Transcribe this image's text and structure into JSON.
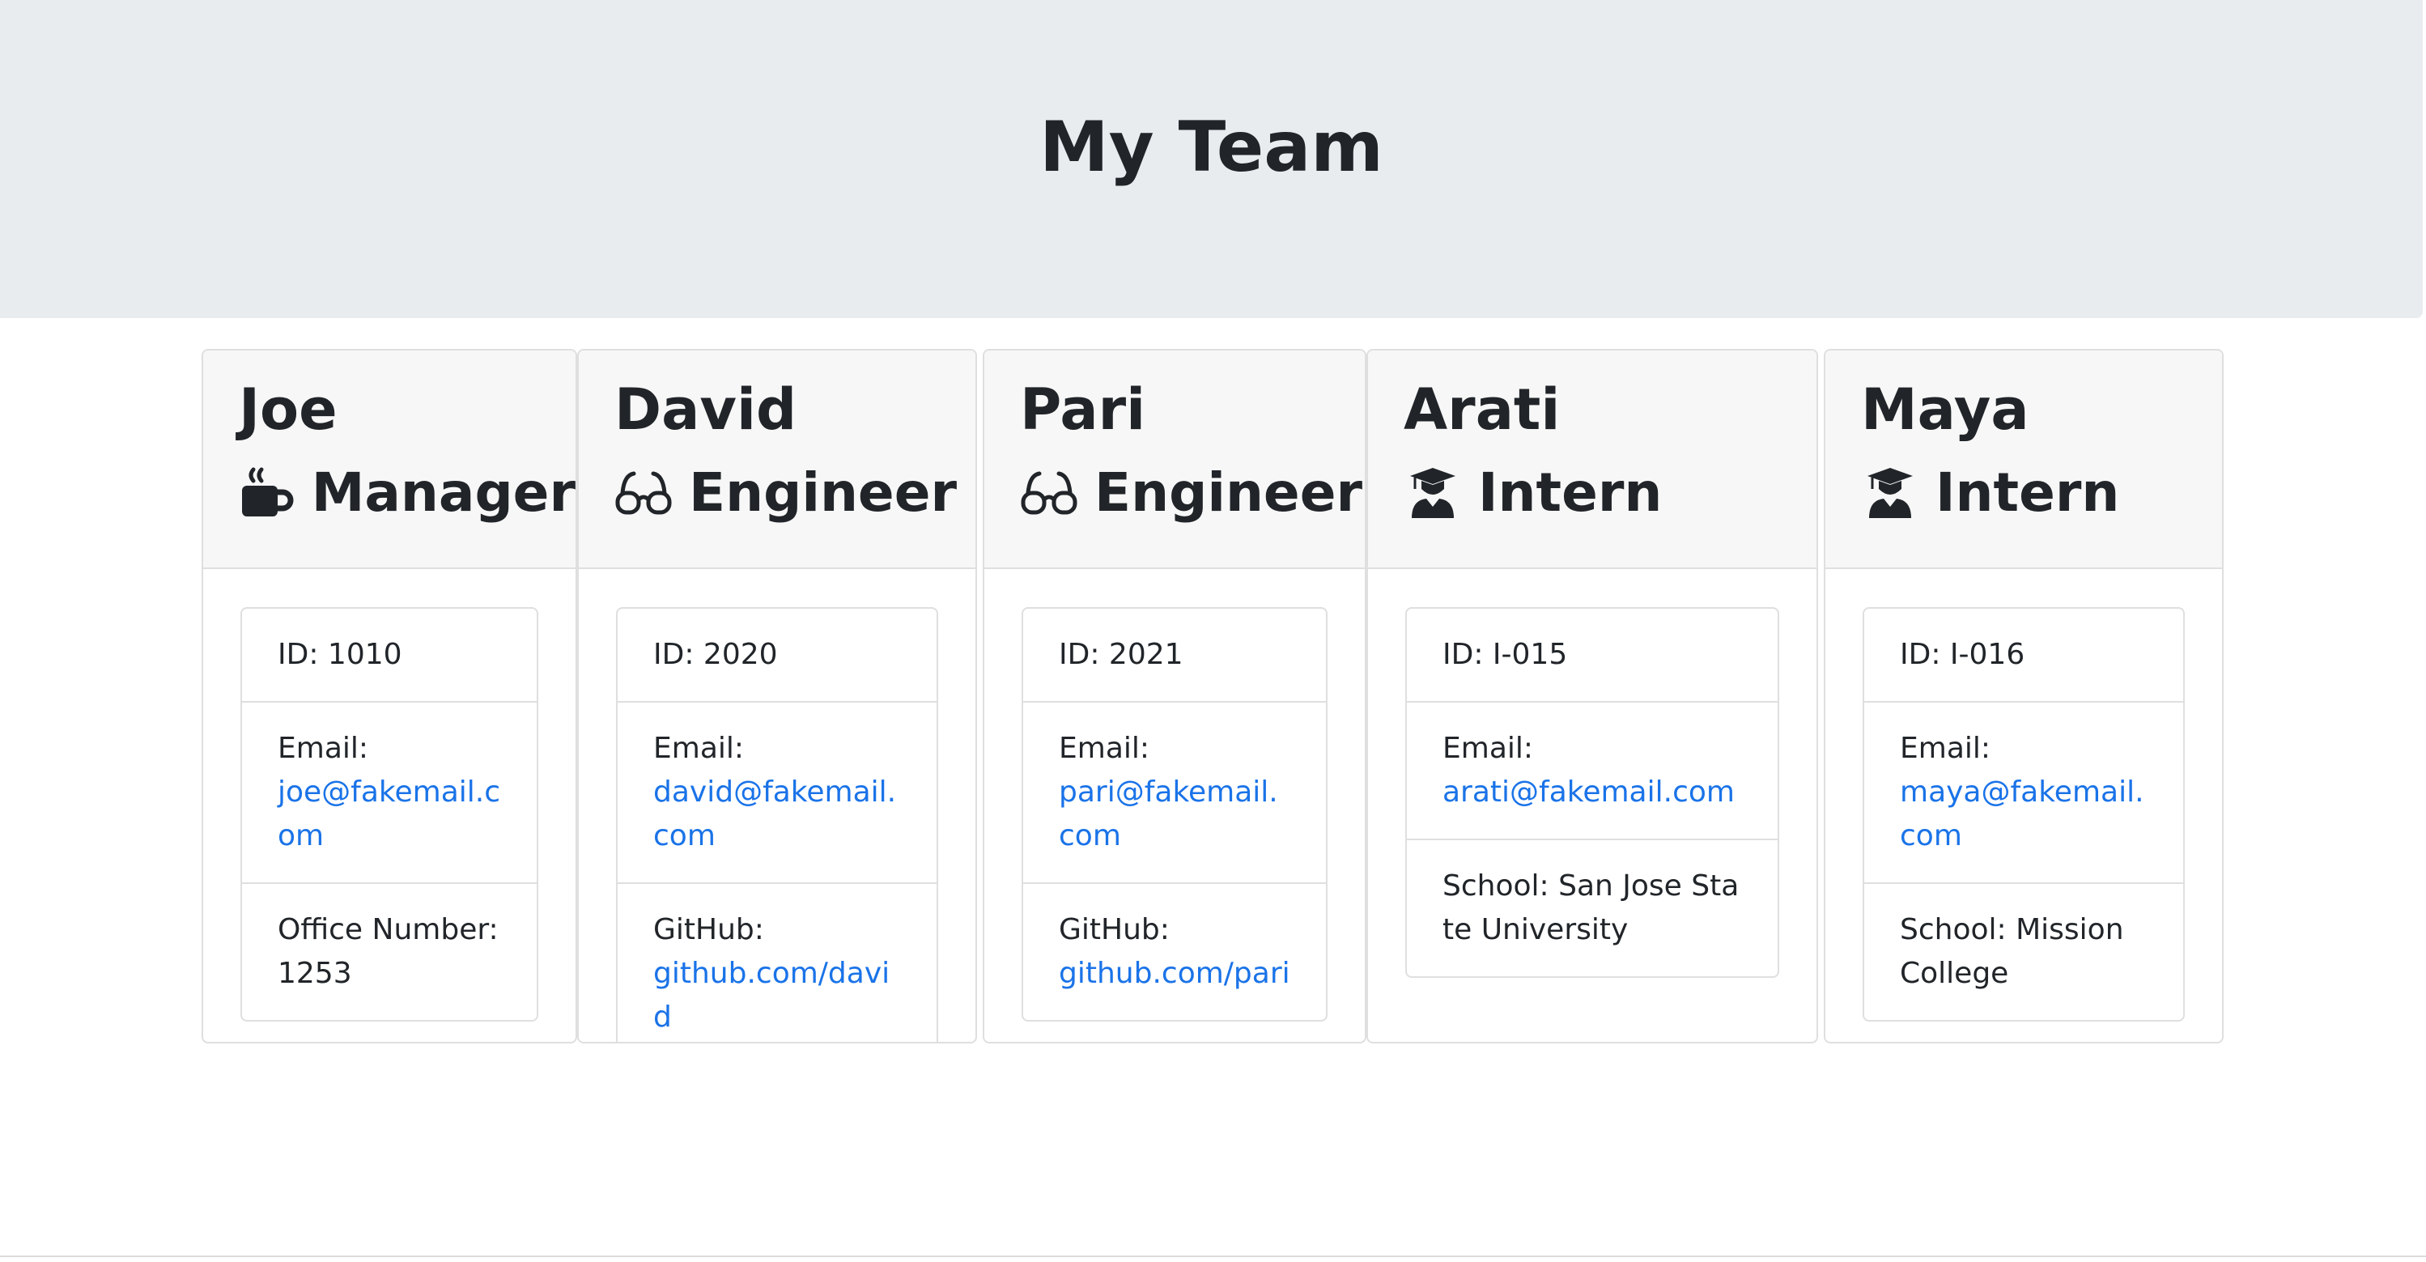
{
  "header": {
    "title": "My Team"
  },
  "team": [
    {
      "name": "Joe",
      "role": "Manager",
      "icon": "coffee-mug-icon",
      "id_label": "ID: 1010",
      "email_label": "Email:",
      "email": "joe@fakemail.com",
      "extra_label": "Office Number:",
      "extra_value": "1253"
    },
    {
      "name": "David",
      "role": "Engineer",
      "icon": "glasses-icon",
      "id_label": "ID: 2020",
      "email_label": "Email:",
      "email": "david@fakemail.com",
      "extra_label": "GitHub:",
      "extra_value": "github.com/david"
    },
    {
      "name": "Pari",
      "role": "Engineer",
      "icon": "glasses-icon",
      "id_label": "ID: 2021",
      "email_label": "Email:",
      "email": "pari@fakemail.com",
      "extra_label": "GitHub:",
      "extra_value": "github.com/pari"
    },
    {
      "name": "Arati",
      "role": "Intern",
      "icon": "graduate-icon",
      "id_label": "ID: I-015",
      "email_label": "Email:",
      "email": "arati@fakemail.com",
      "extra_label": "School:",
      "extra_value": "San Jose State University"
    },
    {
      "name": "Maya",
      "role": "Intern",
      "icon": "graduate-icon",
      "id_label": "ID: I-016",
      "email_label": "Email:",
      "email": "maya@fakemail.com",
      "extra_label": "School:",
      "extra_value": "Mission College"
    }
  ],
  "colors": {
    "link": "#1a73e8",
    "header_bg": "#e9ecef",
    "card_header_bg": "#f7f7f7"
  }
}
